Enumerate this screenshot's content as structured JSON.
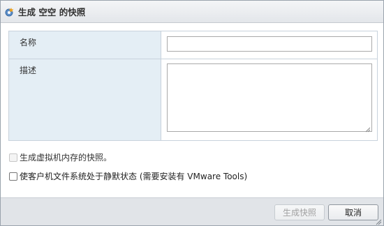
{
  "dialog": {
    "title": "生成 空空 的快照",
    "title_icon": "snapshot-icon"
  },
  "form": {
    "name_label": "名称",
    "name_value": "",
    "description_label": "描述",
    "description_value": ""
  },
  "options": {
    "memory_label": "生成虚拟机内存的快照。",
    "memory_checked": false,
    "memory_enabled": false,
    "quiesce_label": "使客户机文件系统处于静默状态 (需要安装有 VMware Tools)",
    "quiesce_checked": false
  },
  "footer": {
    "snapshot_button": "生成快照",
    "cancel_button": "取消"
  },
  "colors": {
    "label_background": "#e4eef5",
    "footer_background": "#e1e4e8",
    "icon_accent": "#f0a21b"
  }
}
